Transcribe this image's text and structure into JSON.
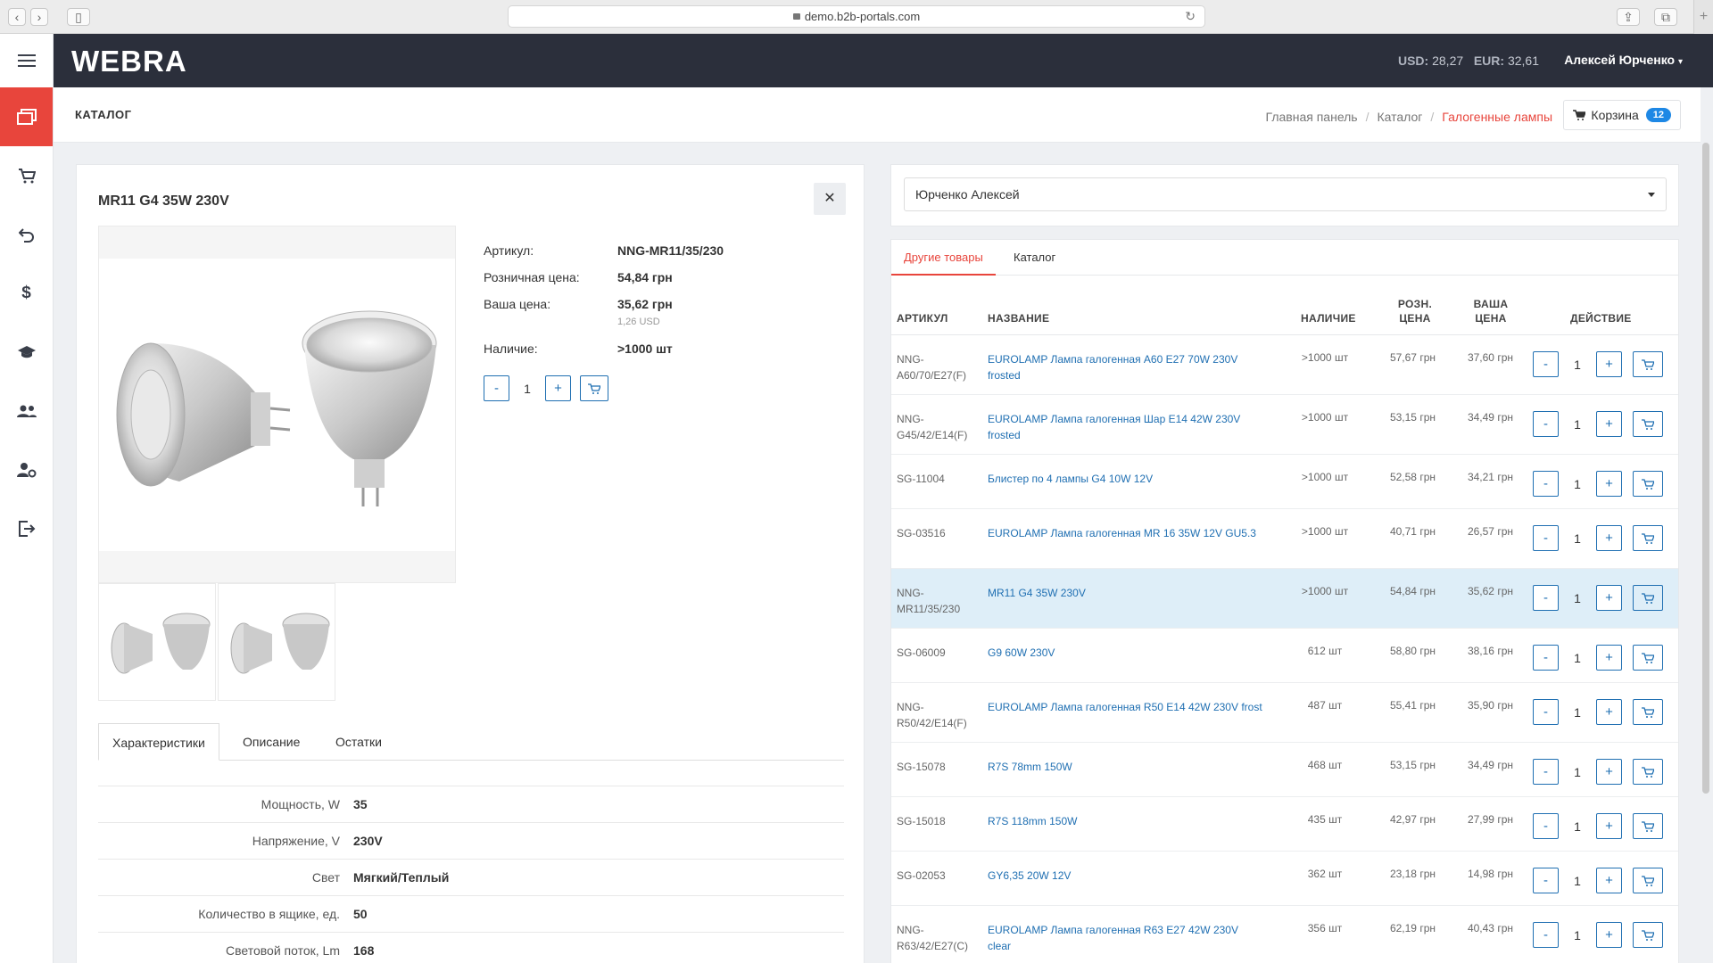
{
  "browser": {
    "url": "demo.b2b-portals.com"
  },
  "header": {
    "logo": "WEBRA",
    "usd_label": "USD:",
    "usd_value": "28,27",
    "eur_label": "EUR:",
    "eur_value": "32,61",
    "user_name": "Алексей Юрченко"
  },
  "subheader": {
    "page_title": "КАТАЛОГ",
    "breadcrumb": [
      "Главная панель",
      "Каталог",
      "Галогенные лампы"
    ],
    "cart_label": "Корзина",
    "cart_count": "12"
  },
  "product": {
    "title": "MR11 G4 35W 230V",
    "article_label": "Артикул:",
    "article_value": "NNG-MR11/35/230",
    "retail_label": "Розничная цена:",
    "retail_value": "54,84 грн",
    "your_label": "Ваша цена:",
    "your_value": "35,62 грн",
    "your_usd": "1,26 USD",
    "stock_label": "Наличие:",
    "stock_value": ">1000 шт",
    "qty": "1",
    "minus": "-",
    "plus": "+",
    "tabs": [
      "Характеристики",
      "Описание",
      "Остатки"
    ],
    "properties": [
      {
        "k": "Мощность, W",
        "v": "35"
      },
      {
        "k": "Напряжение, V",
        "v": "230V"
      },
      {
        "k": "Свет",
        "v": "Мягкий/Теплый"
      },
      {
        "k": "Количество в ящике, ед.",
        "v": "50"
      },
      {
        "k": "Световой поток, Lm",
        "v": "168"
      }
    ]
  },
  "client_select": {
    "value": "Юрченко Алексей"
  },
  "other": {
    "tabs": [
      "Другие товары",
      "Каталог"
    ],
    "columns": {
      "article": "АРТИКУЛ",
      "name": "НАЗВАНИЕ",
      "stock": "НАЛИЧИЕ",
      "retail_1": "РОЗН.",
      "retail_2": "ЦЕНА",
      "your_1": "ВАША",
      "your_2": "ЦЕНА",
      "action": "ДЕЙСТВИЕ"
    },
    "rows": [
      {
        "art": "NNG-A60/70/E27(F)",
        "name": "EUROLAMP Лампа галогенная A60 E27 70W 230V frosted",
        "stock": ">1000 шт",
        "ret": "57,67 грн",
        "your": "37,60 грн",
        "qty": "1"
      },
      {
        "art": "NNG-G45/42/E14(F)",
        "name": "EUROLAMP Лампа галогенная Шар E14 42W 230V frosted",
        "stock": ">1000 шт",
        "ret": "53,15 грн",
        "your": "34,49 грн",
        "qty": "1"
      },
      {
        "art": "SG-11004",
        "name": "Блистер по 4 лампы G4 10W 12V",
        "stock": ">1000 шт",
        "ret": "52,58 грн",
        "your": "34,21 грн",
        "qty": "1"
      },
      {
        "art": "SG-03516",
        "name": "EUROLAMP Лампа галогенная MR 16 35W 12V GU5.3",
        "stock": ">1000 шт",
        "ret": "40,71 грн",
        "your": "26,57 грн",
        "qty": "1"
      },
      {
        "art": "NNG-MR11/35/230",
        "name": "MR11 G4 35W 230V",
        "stock": ">1000 шт",
        "ret": "54,84 грн",
        "your": "35,62 грн",
        "qty": "1"
      },
      {
        "art": "SG-06009",
        "name": "G9 60W 230V",
        "stock": "612 шт",
        "ret": "58,80 грн",
        "your": "38,16 грн",
        "qty": "1"
      },
      {
        "art": "NNG-R50/42/E14(F)",
        "name": "EUROLAMP Лампа галогенная R50 E14 42W 230V frost",
        "stock": "487 шт",
        "ret": "55,41 грн",
        "your": "35,90 грн",
        "qty": "1"
      },
      {
        "art": "SG-15078",
        "name": "R7S 78mm 150W",
        "stock": "468 шт",
        "ret": "53,15 грн",
        "your": "34,49 грн",
        "qty": "1"
      },
      {
        "art": "SG-15018",
        "name": "R7S 118mm 150W",
        "stock": "435 шт",
        "ret": "42,97 грн",
        "your": "27,99 грн",
        "qty": "1"
      },
      {
        "art": "SG-02053",
        "name": "GY6,35 20W 12V",
        "stock": "362 шт",
        "ret": "23,18 грн",
        "your": "14,98 грн",
        "qty": "1"
      },
      {
        "art": "NNG-R63/42/E27(C)",
        "name": "EUROLAMP Лампа галогенная R63 E27 42W 230V clear",
        "stock": "356 шт",
        "ret": "62,19 грн",
        "your": "40,43 грн",
        "qty": "1"
      }
    ]
  }
}
